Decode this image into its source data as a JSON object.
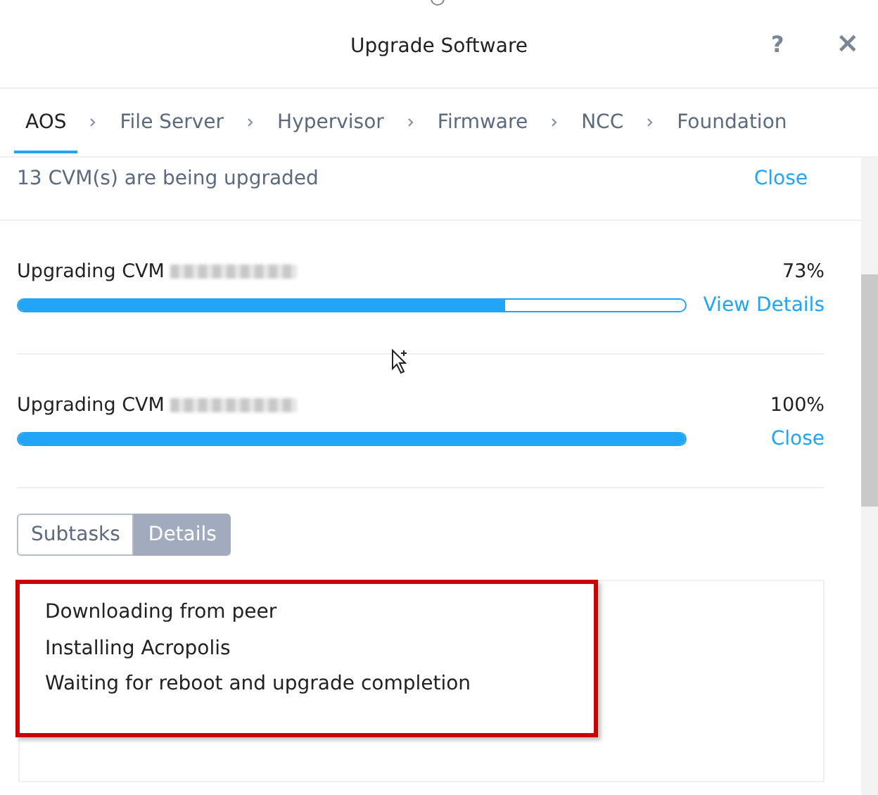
{
  "dialog": {
    "title": "Upgrade Software",
    "help": "?",
    "close": "×"
  },
  "tabs": [
    {
      "label": "AOS",
      "selected": true
    },
    {
      "label": "File Server",
      "selected": false
    },
    {
      "label": "Hypervisor",
      "selected": false
    },
    {
      "label": "Firmware",
      "selected": false
    },
    {
      "label": "NCC",
      "selected": false
    },
    {
      "label": "Foundation",
      "selected": false
    }
  ],
  "summary": {
    "text": "13 CVM(s) are being upgraded",
    "action": "Close"
  },
  "tasks": [
    {
      "name": "Upgrading CVM",
      "percent": "73%",
      "level": 0.73,
      "action": "View Details"
    },
    {
      "name": "Upgrading CVM",
      "percent": "100%",
      "level": 1,
      "action": "Close"
    }
  ],
  "detail_toggle": [
    {
      "label": "Subtasks",
      "selected": false
    },
    {
      "label": "Details",
      "selected": true
    }
  ],
  "details": {
    "highlighted": true,
    "lines": [
      "Downloading from peer",
      "Installing Acropolis",
      "Waiting for reboot and upgrade completion"
    ]
  }
}
